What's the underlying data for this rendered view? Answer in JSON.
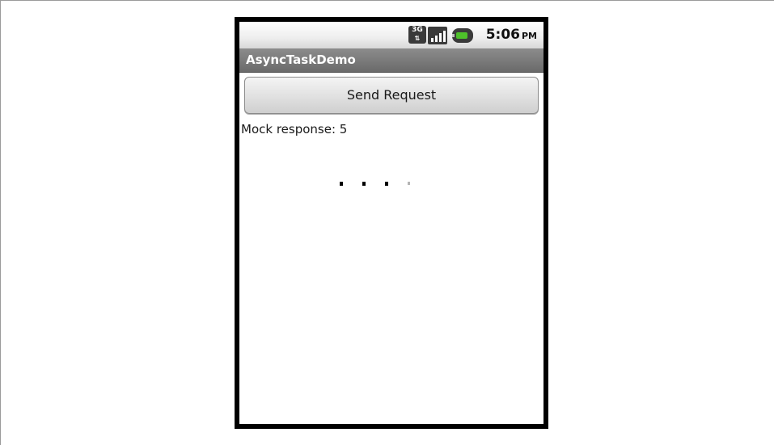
{
  "status_bar": {
    "network_label": "3G",
    "time": "5:06",
    "ampm": "PM",
    "icons": [
      "3g-data-icon",
      "signal-strength-icon",
      "battery-icon"
    ]
  },
  "app": {
    "title": "AsyncTaskDemo"
  },
  "main": {
    "send_button_label": "Send Request",
    "response_text": "Mock response: 5"
  },
  "colors": {
    "title_bar": "#6a6a6a",
    "battery_fill": "#4ec02a",
    "phone_bezel": "#000000"
  }
}
